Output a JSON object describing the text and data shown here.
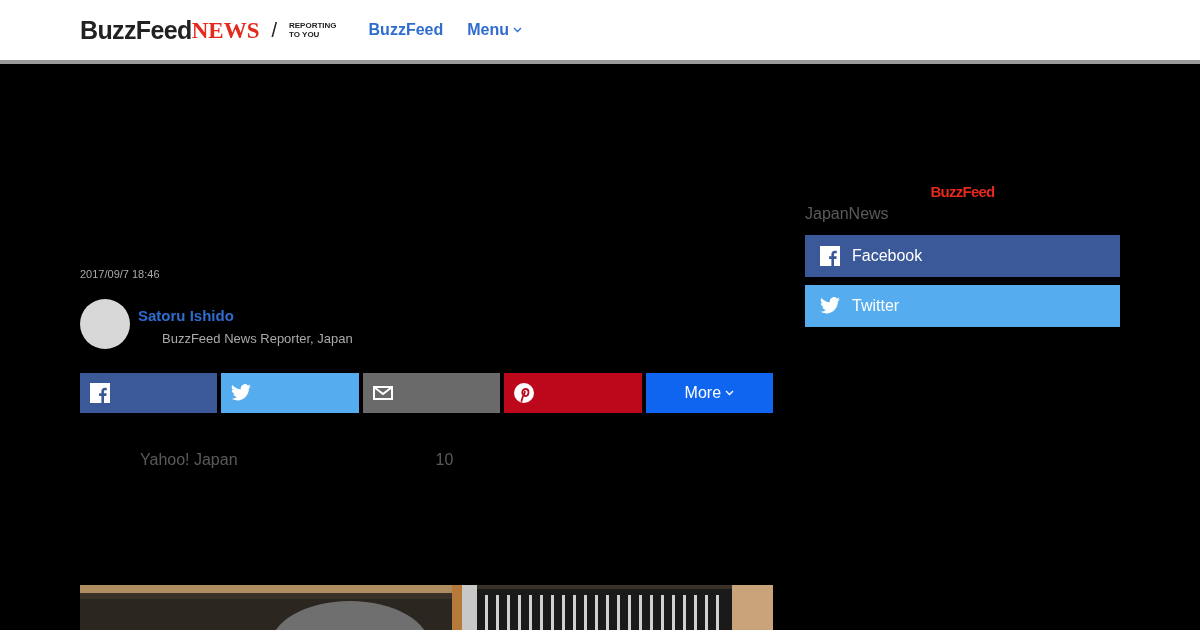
{
  "header": {
    "logo": {
      "brand": "BuzzFeed",
      "section": "NEWS",
      "slash": "/",
      "tagline_1": "REPORTING",
      "tagline_2": "TO YOU"
    },
    "nav": [
      {
        "label": "BuzzFeed",
        "kind": "link"
      },
      {
        "label": "Menu",
        "kind": "dropdown"
      }
    ]
  },
  "article": {
    "timestamp": "2017/09/7 18:46",
    "author": {
      "name": "Satoru Ishido",
      "role": "BuzzFeed News Reporter, Japan"
    },
    "share": [
      {
        "kind": "facebook"
      },
      {
        "kind": "twitter"
      },
      {
        "kind": "email"
      },
      {
        "kind": "pinterest"
      },
      {
        "kind": "more",
        "label": "More"
      }
    ],
    "body": [
      {
        "text": "Yahoo! Japan"
      },
      {
        "text": "10"
      }
    ]
  },
  "sidebar": {
    "brand": "BuzzFeed",
    "title": "JapanNews",
    "follow": [
      {
        "kind": "facebook",
        "label": "Facebook"
      },
      {
        "kind": "twitter",
        "label": "Twitter"
      }
    ]
  }
}
